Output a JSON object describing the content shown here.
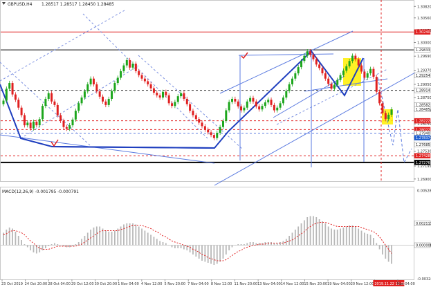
{
  "header": {
    "symbol": "GBPUSD,H4",
    "ohlc": "1.28517 1.28517 1.28450 1.28485"
  },
  "colors": {
    "bull": "#1ca61c",
    "bear": "#e02020",
    "wave": "#1f3fbf",
    "channel": "#5a7ae0",
    "red_level": "#e02020",
    "black_level": "#000000",
    "highlight": "#ffee00",
    "current_price_label": "#1f5fd0",
    "macd_hist": "#b8b8b8",
    "macd_signal": "#e02020"
  },
  "chart_data": [
    {
      "type": "candlestick",
      "title": "",
      "ylim": [
        1.2685,
        1.3095
      ],
      "y_ticks": [
        "1.30820",
        "1.30560",
        "1.30275",
        "1.30000",
        "1.29690",
        "1.29370",
        "1.29050",
        "1.28750",
        "1.28459",
        "1.28150",
        "1.27840",
        "1.27530",
        "1.27195",
        "1.26900"
      ],
      "level_labels": [
        {
          "value": 1.3024,
          "label": "1.30240",
          "style": "red"
        },
        {
          "value": 1.29833,
          "label": "1.29833",
          "style": "white"
        },
        {
          "value": 1.29254,
          "label": "1.29254",
          "style": "white"
        },
        {
          "value": 1.28914,
          "label": "1.28914",
          "style": "white"
        },
        {
          "value": 1.28582,
          "label": "1.28582",
          "style": "white"
        },
        {
          "value": 1.28485,
          "label": "1.28485",
          "style": "white"
        },
        {
          "value": 1.28222,
          "label": "1.28222",
          "style": "red"
        },
        {
          "value": 1.28022,
          "label": "1.28022",
          "style": "red"
        },
        {
          "value": 1.2794,
          "label": "1.27940",
          "style": "white"
        },
        {
          "value": 1.27837,
          "label": "1.27837",
          "style": "blue"
        },
        {
          "value": 1.27685,
          "label": "1.27685",
          "style": "white"
        },
        {
          "value": 1.27428,
          "label": "1.27428",
          "style": "red"
        },
        {
          "value": 1.27276,
          "label": "1.27276",
          "style": "black"
        }
      ],
      "horizontal_levels": [
        {
          "value": 1.3024,
          "style": "red-solid"
        },
        {
          "value": 1.29833,
          "style": "black-solid"
        },
        {
          "value": 1.28914,
          "style": "black-dashed"
        },
        {
          "value": 1.28222,
          "style": "red-dashed"
        },
        {
          "value": 1.28022,
          "style": "red-dashed"
        },
        {
          "value": 1.2794,
          "style": "blue-dashed"
        },
        {
          "value": 1.27428,
          "style": "red-dashed"
        },
        {
          "value": 1.27276,
          "style": "black-thick"
        }
      ],
      "x_labels": [
        "23 Oct 2019",
        "24 Oct 20:00",
        "28 Oct 04:00",
        "29 Oct 12:00",
        "30 Oct 20:00",
        "1 Nov 04:00",
        "4 Nov 12:00",
        "5 Nov 20:00",
        "7 Nov 04:00",
        "8 Nov 12:00",
        "11 Nov 20:00",
        "13 Nov 04:00",
        "14 Nov 12:00",
        "15 Nov 20:00",
        "19 Nov 04:00",
        "20 Nov 12:00",
        "2019.11.22 12:00",
        "Nov 04:00"
      ],
      "closes": [
        1.2868,
        1.2895,
        1.2908,
        1.2882,
        1.287,
        1.2852,
        1.2835,
        1.2812,
        1.2818,
        1.2805,
        1.282,
        1.2812,
        1.2826,
        1.2856,
        1.2872,
        1.2885,
        1.2866,
        1.2858,
        1.2835,
        1.2822,
        1.2808,
        1.2804,
        1.2812,
        1.2825,
        1.2845,
        1.2862,
        1.2875,
        1.2889,
        1.2905,
        1.2918,
        1.2905,
        1.2889,
        1.2877,
        1.2866,
        1.2858,
        1.2872,
        1.289,
        1.2908,
        1.292,
        1.2935,
        1.2948,
        1.296,
        1.2943,
        1.2952,
        1.2935,
        1.2926,
        1.2918,
        1.2912,
        1.2905,
        1.2896,
        1.2886,
        1.288,
        1.2875,
        1.2888,
        1.288,
        1.2862,
        1.2856,
        1.2865,
        1.2878,
        1.2885,
        1.2872,
        1.286,
        1.2845,
        1.2835,
        1.2826,
        1.2818,
        1.281,
        1.2802,
        1.2796,
        1.279,
        1.2783,
        1.2795,
        1.2808,
        1.2822,
        1.2846,
        1.2865,
        1.2872,
        1.2866,
        1.2855,
        1.2846,
        1.2852,
        1.2866,
        1.2874,
        1.2866,
        1.2855,
        1.2848,
        1.2856,
        1.2864,
        1.287,
        1.2858,
        1.2846,
        1.2852,
        1.2862,
        1.2875,
        1.289,
        1.2905,
        1.2918,
        1.293,
        1.2944,
        1.2958,
        1.297,
        1.298,
        1.2972,
        1.2962,
        1.295,
        1.2942,
        1.293,
        1.2918,
        1.2906,
        1.2895,
        1.2904,
        1.2915,
        1.2926,
        1.2936,
        1.2946,
        1.2958,
        1.297,
        1.2962,
        1.2948,
        1.2934,
        1.292,
        1.293,
        1.294,
        1.2922,
        1.2888,
        1.2862,
        1.284,
        1.2826,
        1.2836,
        1.2848
      ]
    },
    {
      "type": "bar",
      "title": "MACD(12,26,9) -0.001795 -0.000791",
      "ylim": [
        -0.0033,
        0.0055
      ],
      "y_ticks": [
        "0.005282",
        "0.000000",
        "-0.003246"
      ],
      "level_labels": [
        {
          "value": 0.002113,
          "label": "0.002113",
          "style": "white"
        },
        {
          "value": 0.0,
          "label": "0.000000",
          "style": "white"
        }
      ],
      "histogram": [
        0.0012,
        0.0015,
        0.0017,
        0.0016,
        0.0013,
        0.0009,
        0.0005,
        0.0001,
        -0.0002,
        -0.0005,
        -0.0007,
        -0.0008,
        -0.0007,
        -0.0005,
        -0.0003,
        -0.0001,
        0.0001,
        0.0002,
        0.0001,
        0.0,
        -0.0001,
        -0.0002,
        -0.0002,
        -0.0001,
        0.0001,
        0.0003,
        0.0006,
        0.0009,
        0.0012,
        0.0015,
        0.0017,
        0.0018,
        0.0018,
        0.0016,
        0.0014,
        0.0013,
        0.0013,
        0.0014,
        0.0016,
        0.0018,
        0.002,
        0.0021,
        0.0021,
        0.0021,
        0.002,
        0.0018,
        0.0016,
        0.0014,
        0.0012,
        0.001,
        0.0008,
        0.0006,
        0.0004,
        0.0003,
        0.0002,
        0.0,
        -0.0002,
        -0.0003,
        -0.0003,
        -0.0003,
        -0.0004,
        -0.0005,
        -0.0007,
        -0.0009,
        -0.0011,
        -0.0013,
        -0.0015,
        -0.0016,
        -0.0017,
        -0.0018,
        -0.0019,
        -0.0018,
        -0.0016,
        -0.0013,
        -0.0009,
        -0.0005,
        -0.0002,
        0.0,
        0.0001,
        0.0001,
        0.0001,
        0.0002,
        0.0003,
        0.0003,
        0.0002,
        0.0002,
        0.0002,
        0.0003,
        0.0003,
        0.0003,
        0.0002,
        0.0002,
        0.0003,
        0.0004,
        0.0006,
        0.0009,
        0.0012,
        0.0015,
        0.0018,
        0.0021,
        0.0024,
        0.0027,
        0.0028,
        0.0028,
        0.0027,
        0.0025,
        0.0023,
        0.0021,
        0.0018,
        0.0016,
        0.0015,
        0.0015,
        0.0016,
        0.0017,
        0.0018,
        0.0019,
        0.0019,
        0.0018,
        0.0016,
        0.0014,
        0.0012,
        0.0011,
        0.001,
        0.0007,
        0.0002,
        -0.0004,
        -0.0009,
        -0.0013,
        -0.0016,
        -0.0018
      ],
      "signal": [
        0.001,
        0.0011,
        0.0013,
        0.0014,
        0.0014,
        0.0013,
        0.0012,
        0.001,
        0.0007,
        0.0004,
        0.0002,
        -0.0001,
        -0.0003,
        -0.0004,
        -0.0004,
        -0.0004,
        -0.0003,
        -0.0002,
        -0.0001,
        -0.0001,
        -0.0001,
        -0.0001,
        -0.0001,
        -0.0001,
        -0.0001,
        0.0,
        0.0001,
        0.0003,
        0.0005,
        0.0007,
        0.0009,
        0.0011,
        0.0013,
        0.0014,
        0.0014,
        0.0014,
        0.0014,
        0.0014,
        0.0014,
        0.0015,
        0.0016,
        0.0017,
        0.0018,
        0.0019,
        0.0019,
        0.0019,
        0.0019,
        0.0018,
        0.0017,
        0.0016,
        0.0014,
        0.0013,
        0.0011,
        0.0009,
        0.0008,
        0.0006,
        0.0004,
        0.0003,
        0.0002,
        0.0001,
        0.0,
        -0.0001,
        -0.0002,
        -0.0004,
        -0.0005,
        -0.0007,
        -0.0009,
        -0.001,
        -0.0012,
        -0.0013,
        -0.0014,
        -0.0015,
        -0.0015,
        -0.0015,
        -0.0014,
        -0.0012,
        -0.001,
        -0.0008,
        -0.0006,
        -0.0005,
        -0.0003,
        -0.0002,
        -0.0001,
        0.0,
        0.0,
        0.0001,
        0.0001,
        0.0001,
        0.0002,
        0.0002,
        0.0002,
        0.0002,
        0.0002,
        0.0002,
        0.0003,
        0.0004,
        0.0005,
        0.0007,
        0.0009,
        0.0011,
        0.0013,
        0.0016,
        0.0018,
        0.002,
        0.0021,
        0.0022,
        0.0022,
        0.0022,
        0.0021,
        0.002,
        0.0019,
        0.0018,
        0.0018,
        0.0018,
        0.0018,
        0.0018,
        0.0018,
        0.0018,
        0.0018,
        0.0017,
        0.0016,
        0.0015,
        0.0014,
        0.0013,
        0.0011,
        0.0008,
        0.0004,
        0.0,
        -0.0004,
        -0.0008
      ]
    }
  ]
}
